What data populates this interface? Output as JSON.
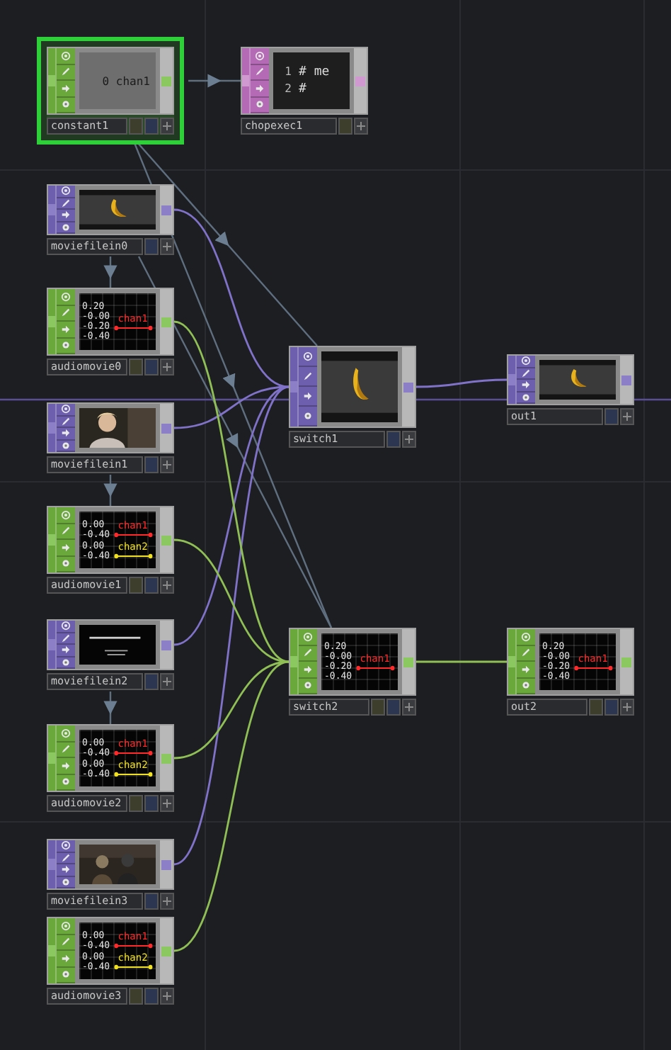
{
  "nodes": [
    {
      "name": "constant1",
      "kind": "chop",
      "selected": true,
      "viewer": {
        "kind": "value",
        "text": "0 chan1"
      }
    },
    {
      "name": "chopexec1",
      "kind": "dat",
      "selected": false,
      "viewer": {
        "kind": "code",
        "lines": [
          {
            "number": "1",
            "text": "# me"
          },
          {
            "number": "2",
            "text": "#"
          }
        ]
      }
    },
    {
      "name": "moviefilein0",
      "kind": "top",
      "selected": false
    },
    {
      "name": "audiomovie0",
      "kind": "chop",
      "selected": false,
      "viewer": {
        "kind": "chart",
        "channels": [
          {
            "name": "chan1",
            "color": "#ff2a2a",
            "labels": [
              "0.20",
              "-0.00",
              "-0.20",
              "-0.40"
            ]
          }
        ]
      }
    },
    {
      "name": "moviefilein1",
      "kind": "top",
      "selected": false
    },
    {
      "name": "audiomovie1",
      "kind": "chop",
      "selected": false,
      "viewer": {
        "kind": "chart",
        "channels": [
          {
            "name": "chan1",
            "color": "#ff2a2a",
            "labels": [
              "0.00",
              "-0.40"
            ]
          },
          {
            "name": "chan2",
            "color": "#f0e020",
            "labels": [
              "0.00",
              "-0.40"
            ]
          }
        ]
      }
    },
    {
      "name": "moviefilein2",
      "kind": "top",
      "selected": false
    },
    {
      "name": "audiomovie2",
      "kind": "chop",
      "selected": false,
      "viewer": {
        "kind": "chart",
        "channels": [
          {
            "name": "chan1",
            "color": "#ff2a2a",
            "labels": [
              "0.00",
              "-0.40"
            ]
          },
          {
            "name": "chan2",
            "color": "#f0e020",
            "labels": [
              "0.00",
              "-0.40"
            ]
          }
        ]
      }
    },
    {
      "name": "moviefilein3",
      "kind": "top",
      "selected": false
    },
    {
      "name": "audiomovie3",
      "kind": "chop",
      "selected": false,
      "viewer": {
        "kind": "chart",
        "channels": [
          {
            "name": "chan1",
            "color": "#ff2a2a",
            "labels": [
              "0.00",
              "-0.40"
            ]
          },
          {
            "name": "chan2",
            "color": "#f0e020",
            "labels": [
              "0.00",
              "-0.40"
            ]
          }
        ]
      }
    },
    {
      "name": "switch1",
      "kind": "top",
      "selected": false
    },
    {
      "name": "out1",
      "kind": "top",
      "selected": false
    },
    {
      "name": "switch2",
      "kind": "chop",
      "selected": false,
      "viewer": {
        "kind": "chart",
        "channels": [
          {
            "name": "chan1",
            "color": "#ff2a2a",
            "labels": [
              "0.20",
              "-0.00",
              "-0.20",
              "-0.40"
            ]
          }
        ]
      }
    },
    {
      "name": "out2",
      "kind": "chop",
      "selected": false,
      "viewer": {
        "kind": "chart",
        "channels": [
          {
            "name": "chan1",
            "color": "#ff2a2a",
            "labels": [
              "0.20",
              "-0.00",
              "-0.20",
              "-0.40"
            ]
          }
        ]
      }
    }
  ]
}
